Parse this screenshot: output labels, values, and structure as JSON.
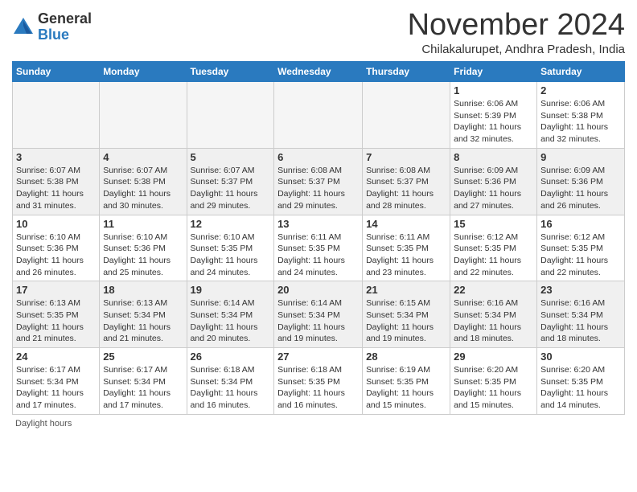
{
  "header": {
    "logo_general": "General",
    "logo_blue": "Blue",
    "month_title": "November 2024",
    "location": "Chilakalurupet, Andhra Pradesh, India"
  },
  "weekdays": [
    "Sunday",
    "Monday",
    "Tuesday",
    "Wednesday",
    "Thursday",
    "Friday",
    "Saturday"
  ],
  "footer": "Daylight hours",
  "weeks": [
    [
      {
        "day": "",
        "empty": true
      },
      {
        "day": "",
        "empty": true
      },
      {
        "day": "",
        "empty": true
      },
      {
        "day": "",
        "empty": true
      },
      {
        "day": "",
        "empty": true
      },
      {
        "day": "1",
        "sunrise": "Sunrise: 6:06 AM",
        "sunset": "Sunset: 5:39 PM",
        "daylight": "Daylight: 11 hours and 32 minutes."
      },
      {
        "day": "2",
        "sunrise": "Sunrise: 6:06 AM",
        "sunset": "Sunset: 5:38 PM",
        "daylight": "Daylight: 11 hours and 32 minutes."
      }
    ],
    [
      {
        "day": "3",
        "sunrise": "Sunrise: 6:07 AM",
        "sunset": "Sunset: 5:38 PM",
        "daylight": "Daylight: 11 hours and 31 minutes."
      },
      {
        "day": "4",
        "sunrise": "Sunrise: 6:07 AM",
        "sunset": "Sunset: 5:38 PM",
        "daylight": "Daylight: 11 hours and 30 minutes."
      },
      {
        "day": "5",
        "sunrise": "Sunrise: 6:07 AM",
        "sunset": "Sunset: 5:37 PM",
        "daylight": "Daylight: 11 hours and 29 minutes."
      },
      {
        "day": "6",
        "sunrise": "Sunrise: 6:08 AM",
        "sunset": "Sunset: 5:37 PM",
        "daylight": "Daylight: 11 hours and 29 minutes."
      },
      {
        "day": "7",
        "sunrise": "Sunrise: 6:08 AM",
        "sunset": "Sunset: 5:37 PM",
        "daylight": "Daylight: 11 hours and 28 minutes."
      },
      {
        "day": "8",
        "sunrise": "Sunrise: 6:09 AM",
        "sunset": "Sunset: 5:36 PM",
        "daylight": "Daylight: 11 hours and 27 minutes."
      },
      {
        "day": "9",
        "sunrise": "Sunrise: 6:09 AM",
        "sunset": "Sunset: 5:36 PM",
        "daylight": "Daylight: 11 hours and 26 minutes."
      }
    ],
    [
      {
        "day": "10",
        "sunrise": "Sunrise: 6:10 AM",
        "sunset": "Sunset: 5:36 PM",
        "daylight": "Daylight: 11 hours and 26 minutes."
      },
      {
        "day": "11",
        "sunrise": "Sunrise: 6:10 AM",
        "sunset": "Sunset: 5:36 PM",
        "daylight": "Daylight: 11 hours and 25 minutes."
      },
      {
        "day": "12",
        "sunrise": "Sunrise: 6:10 AM",
        "sunset": "Sunset: 5:35 PM",
        "daylight": "Daylight: 11 hours and 24 minutes."
      },
      {
        "day": "13",
        "sunrise": "Sunrise: 6:11 AM",
        "sunset": "Sunset: 5:35 PM",
        "daylight": "Daylight: 11 hours and 24 minutes."
      },
      {
        "day": "14",
        "sunrise": "Sunrise: 6:11 AM",
        "sunset": "Sunset: 5:35 PM",
        "daylight": "Daylight: 11 hours and 23 minutes."
      },
      {
        "day": "15",
        "sunrise": "Sunrise: 6:12 AM",
        "sunset": "Sunset: 5:35 PM",
        "daylight": "Daylight: 11 hours and 22 minutes."
      },
      {
        "day": "16",
        "sunrise": "Sunrise: 6:12 AM",
        "sunset": "Sunset: 5:35 PM",
        "daylight": "Daylight: 11 hours and 22 minutes."
      }
    ],
    [
      {
        "day": "17",
        "sunrise": "Sunrise: 6:13 AM",
        "sunset": "Sunset: 5:35 PM",
        "daylight": "Daylight: 11 hours and 21 minutes."
      },
      {
        "day": "18",
        "sunrise": "Sunrise: 6:13 AM",
        "sunset": "Sunset: 5:34 PM",
        "daylight": "Daylight: 11 hours and 21 minutes."
      },
      {
        "day": "19",
        "sunrise": "Sunrise: 6:14 AM",
        "sunset": "Sunset: 5:34 PM",
        "daylight": "Daylight: 11 hours and 20 minutes."
      },
      {
        "day": "20",
        "sunrise": "Sunrise: 6:14 AM",
        "sunset": "Sunset: 5:34 PM",
        "daylight": "Daylight: 11 hours and 19 minutes."
      },
      {
        "day": "21",
        "sunrise": "Sunrise: 6:15 AM",
        "sunset": "Sunset: 5:34 PM",
        "daylight": "Daylight: 11 hours and 19 minutes."
      },
      {
        "day": "22",
        "sunrise": "Sunrise: 6:16 AM",
        "sunset": "Sunset: 5:34 PM",
        "daylight": "Daylight: 11 hours and 18 minutes."
      },
      {
        "day": "23",
        "sunrise": "Sunrise: 6:16 AM",
        "sunset": "Sunset: 5:34 PM",
        "daylight": "Daylight: 11 hours and 18 minutes."
      }
    ],
    [
      {
        "day": "24",
        "sunrise": "Sunrise: 6:17 AM",
        "sunset": "Sunset: 5:34 PM",
        "daylight": "Daylight: 11 hours and 17 minutes."
      },
      {
        "day": "25",
        "sunrise": "Sunrise: 6:17 AM",
        "sunset": "Sunset: 5:34 PM",
        "daylight": "Daylight: 11 hours and 17 minutes."
      },
      {
        "day": "26",
        "sunrise": "Sunrise: 6:18 AM",
        "sunset": "Sunset: 5:34 PM",
        "daylight": "Daylight: 11 hours and 16 minutes."
      },
      {
        "day": "27",
        "sunrise": "Sunrise: 6:18 AM",
        "sunset": "Sunset: 5:35 PM",
        "daylight": "Daylight: 11 hours and 16 minutes."
      },
      {
        "day": "28",
        "sunrise": "Sunrise: 6:19 AM",
        "sunset": "Sunset: 5:35 PM",
        "daylight": "Daylight: 11 hours and 15 minutes."
      },
      {
        "day": "29",
        "sunrise": "Sunrise: 6:20 AM",
        "sunset": "Sunset: 5:35 PM",
        "daylight": "Daylight: 11 hours and 15 minutes."
      },
      {
        "day": "30",
        "sunrise": "Sunrise: 6:20 AM",
        "sunset": "Sunset: 5:35 PM",
        "daylight": "Daylight: 11 hours and 14 minutes."
      }
    ]
  ]
}
